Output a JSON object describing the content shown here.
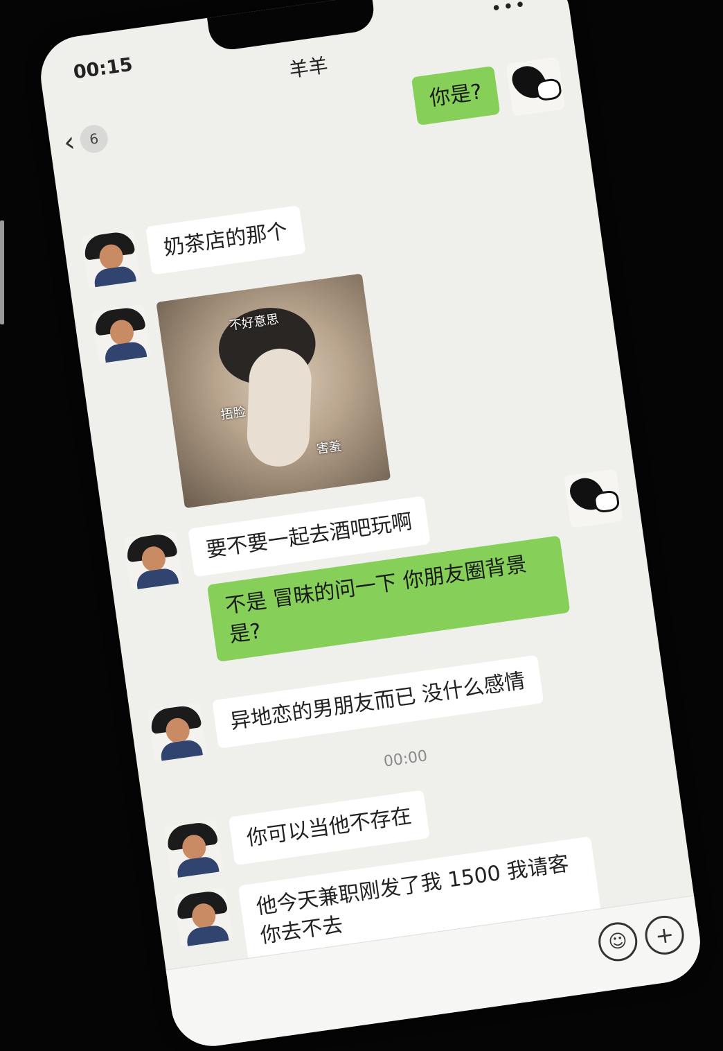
{
  "status": {
    "time": "00:15",
    "more": "•••"
  },
  "header": {
    "title": "羊羊",
    "back_icon": "chevron-left-icon",
    "unread_count": "6"
  },
  "messages": [
    {
      "from": "me",
      "type": "text",
      "text": "你是?"
    },
    {
      "from": "friend",
      "type": "text",
      "text": "奶茶店的那个"
    },
    {
      "from": "friend",
      "type": "sticker",
      "captions": [
        "不好意思",
        "捂脸",
        "害羞"
      ]
    },
    {
      "from": "friend",
      "type": "text",
      "text": "要不要一起去酒吧玩啊"
    },
    {
      "from": "me",
      "type": "text",
      "text": "不是 冒昧的问一下 你朋友圈背景是?"
    },
    {
      "from": "friend",
      "type": "text",
      "text": "异地恋的男朋友而已 没什么感情"
    },
    {
      "from": "system",
      "type": "time",
      "text": "00:00"
    },
    {
      "from": "friend",
      "type": "text",
      "text": "你可以当他不存在"
    },
    {
      "from": "friend",
      "type": "text",
      "text": "他今天兼职刚发了我 1500 我请客你去不去"
    }
  ],
  "input_bar": {
    "emoji_icon": "emoji-icon",
    "plus_icon": "plus-icon"
  },
  "colors": {
    "green_bubble": "#86d05a",
    "white_bubble": "#ffffff",
    "background": "#efefec"
  }
}
